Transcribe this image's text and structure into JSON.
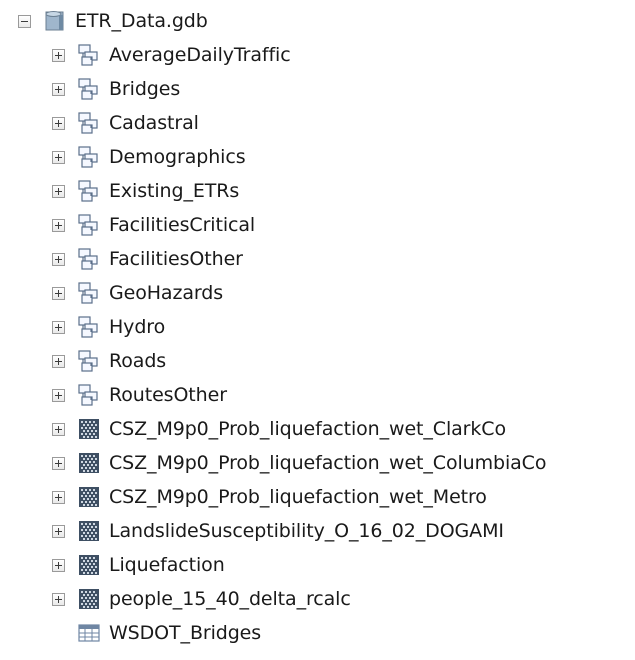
{
  "root": {
    "label": "ETR_Data.gdb",
    "icon": "geodatabase-icon",
    "expanded": true
  },
  "items": [
    {
      "label": "AverageDailyTraffic",
      "icon": "feature-dataset-icon",
      "expandable": true
    },
    {
      "label": "Bridges",
      "icon": "feature-dataset-icon",
      "expandable": true
    },
    {
      "label": "Cadastral",
      "icon": "feature-dataset-icon",
      "expandable": true
    },
    {
      "label": "Demographics",
      "icon": "feature-dataset-icon",
      "expandable": true
    },
    {
      "label": "Existing_ETRs",
      "icon": "feature-dataset-icon",
      "expandable": true
    },
    {
      "label": "FacilitiesCritical",
      "icon": "feature-dataset-icon",
      "expandable": true
    },
    {
      "label": "FacilitiesOther",
      "icon": "feature-dataset-icon",
      "expandable": true
    },
    {
      "label": "GeoHazards",
      "icon": "feature-dataset-icon",
      "expandable": true
    },
    {
      "label": "Hydro",
      "icon": "feature-dataset-icon",
      "expandable": true
    },
    {
      "label": "Roads",
      "icon": "feature-dataset-icon",
      "expandable": true
    },
    {
      "label": "RoutesOther",
      "icon": "feature-dataset-icon",
      "expandable": true
    },
    {
      "label": "CSZ_M9p0_Prob_liquefaction_wet_ClarkCo",
      "icon": "raster-dataset-icon",
      "expandable": true
    },
    {
      "label": "CSZ_M9p0_Prob_liquefaction_wet_ColumbiaCo",
      "icon": "raster-dataset-icon",
      "expandable": true
    },
    {
      "label": "CSZ_M9p0_Prob_liquefaction_wet_Metro",
      "icon": "raster-dataset-icon",
      "expandable": true
    },
    {
      "label": "LandslideSusceptibility_O_16_02_DOGAMI",
      "icon": "raster-dataset-icon",
      "expandable": true
    },
    {
      "label": "Liquefaction",
      "icon": "raster-dataset-icon",
      "expandable": true
    },
    {
      "label": "people_15_40_delta_rcalc",
      "icon": "raster-dataset-icon",
      "expandable": true
    },
    {
      "label": "WSDOT_Bridges",
      "icon": "table-icon",
      "expandable": false
    }
  ]
}
